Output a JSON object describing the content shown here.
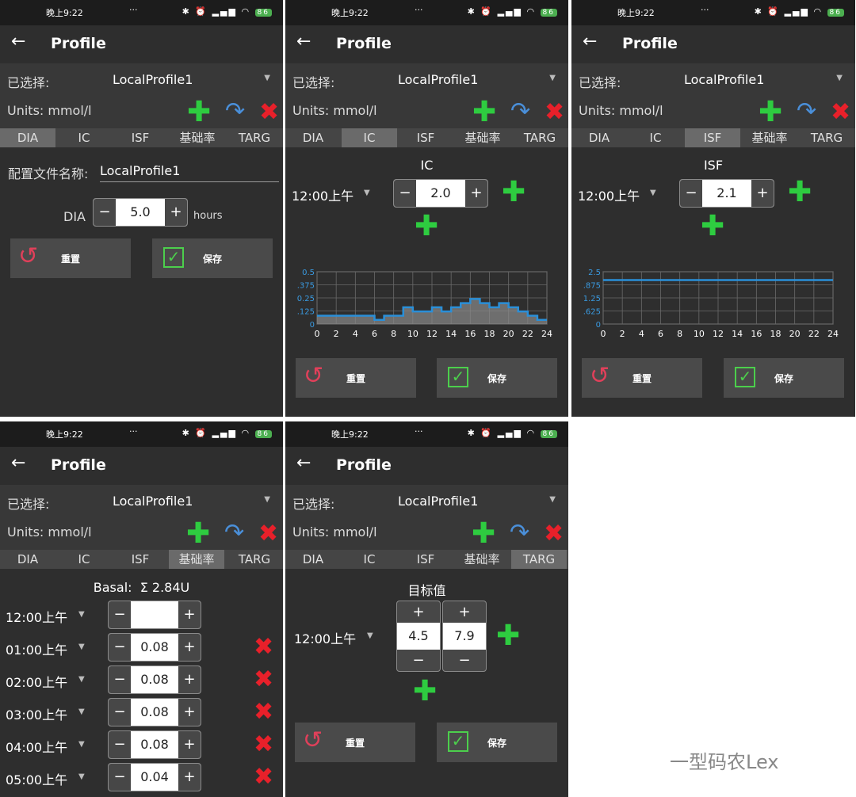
{
  "status": {
    "time": "晚上9:22",
    "dots": "···",
    "battery": "86"
  },
  "app": {
    "title": "Profile"
  },
  "profile": {
    "selected_label": "已选择:",
    "selected_value": "LocalProfile1",
    "units": "Units: mmol/l"
  },
  "tabs": [
    "DIA",
    "IC",
    "ISF",
    "基础率",
    "TARG"
  ],
  "buttons": {
    "reset": "重置",
    "save": "保存"
  },
  "dia": {
    "name_label": "配置文件名称:",
    "name_value": "LocalProfile1",
    "label": "DIA",
    "value": "5.0",
    "unit": "hours"
  },
  "ic": {
    "header": "IC",
    "time": "12:00上午",
    "value": "2.0"
  },
  "isf": {
    "header": "ISF",
    "time": "12:00上午",
    "value": "2.1"
  },
  "basal": {
    "header": "Basal:",
    "total": "Σ 2.84U",
    "rows": [
      {
        "time": "12:00上午",
        "value": ""
      },
      {
        "time": "01:00上午",
        "value": "0.08"
      },
      {
        "time": "02:00上午",
        "value": "0.08"
      },
      {
        "time": "03:00上午",
        "value": "0.08"
      },
      {
        "time": "04:00上午",
        "value": "0.08"
      },
      {
        "time": "05:00上午",
        "value": "0.04"
      }
    ]
  },
  "targ": {
    "header": "目标值",
    "time": "12:00上午",
    "low": "4.5",
    "high": "7.9"
  },
  "chart_data": [
    {
      "type": "area",
      "x_ticks": [
        "0",
        "2",
        "4",
        "6",
        "8",
        "10",
        "12",
        "14",
        "16",
        "18",
        "20",
        "22",
        "24"
      ],
      "y_ticks": [
        "0.5",
        ".375",
        "0.25",
        ".125",
        "0"
      ],
      "xlim": [
        0,
        24
      ],
      "ylim": [
        0,
        0.5
      ],
      "x": [
        0,
        1,
        2,
        3,
        4,
        5,
        6,
        7,
        8,
        9,
        10,
        11,
        12,
        13,
        14,
        15,
        16,
        17,
        18,
        19,
        20,
        21,
        22,
        23,
        24
      ],
      "values": [
        0.08,
        0.08,
        0.08,
        0.08,
        0.08,
        0.08,
        0.04,
        0.08,
        0.08,
        0.16,
        0.12,
        0.12,
        0.16,
        0.12,
        0.16,
        0.2,
        0.24,
        0.2,
        0.16,
        0.2,
        0.16,
        0.12,
        0.08,
        0.04,
        0.04
      ],
      "grid": true,
      "color": "#2a8fd8"
    },
    {
      "type": "line",
      "x_ticks": [
        "0",
        "2",
        "4",
        "6",
        "8",
        "10",
        "12",
        "14",
        "16",
        "18",
        "20",
        "22",
        "24"
      ],
      "y_ticks": [
        "2.5",
        ".875",
        "1.25",
        ".625",
        "0"
      ],
      "xlim": [
        0,
        24
      ],
      "ylim": [
        0,
        2.5
      ],
      "x": [
        0,
        24
      ],
      "values": [
        2.1,
        2.1
      ],
      "grid": true,
      "color": "#2a8fd8"
    }
  ],
  "watermark": "一型码农Lex",
  "colors": {
    "add": "#2ecc40",
    "delete": "#e8202a",
    "undo": "#4a8fd9",
    "bg": "#2e2e2e"
  },
  "icons": {
    "add": "plus-icon",
    "undo": "redo-icon",
    "delete": "close-icon",
    "back": "back-arrow-icon",
    "reset": "reset-icon",
    "save": "checkbox-icon"
  }
}
